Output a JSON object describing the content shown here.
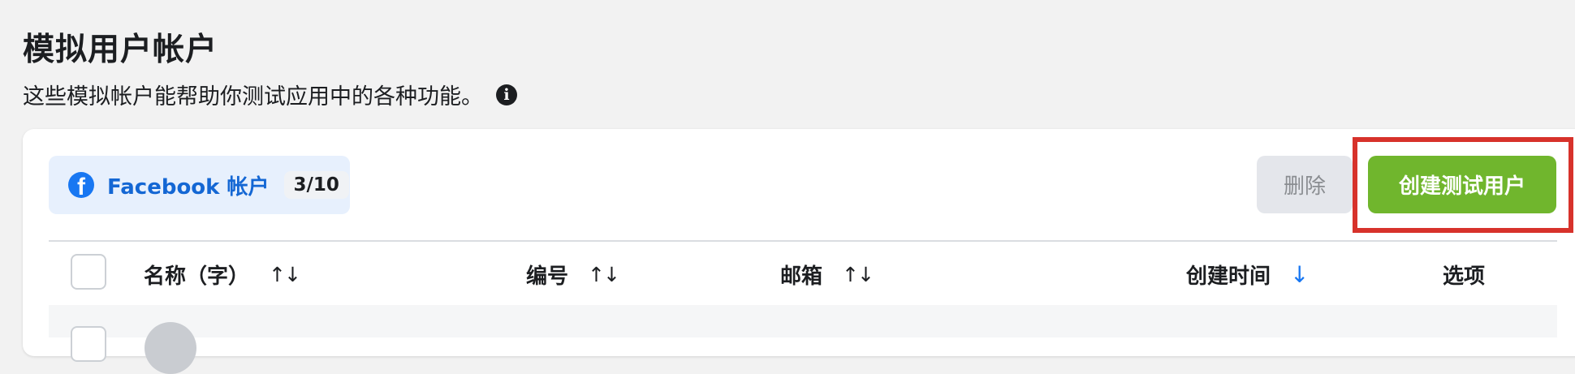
{
  "page": {
    "title": "模拟用户帐户",
    "subtitle": "这些模拟帐户能帮助你测试应用中的各种功能。",
    "info_icon": "info-icon"
  },
  "accounts_tab": {
    "icon": "facebook-icon",
    "label": "Facebook 帐户",
    "count": "3/10"
  },
  "toolbar": {
    "delete_label": "删除",
    "create_label": "创建测试用户"
  },
  "table": {
    "columns": [
      {
        "label": "名称（字）",
        "sort": "↑↓"
      },
      {
        "label": "编号",
        "sort": "↑↓"
      },
      {
        "label": "邮箱",
        "sort": "↑↓"
      },
      {
        "label": "创建时间",
        "sort": "↓"
      },
      {
        "label": "选项",
        "sort": ""
      }
    ]
  },
  "colors": {
    "accent_blue": "#1877f2",
    "create_green": "#70b62d",
    "highlight_red": "#d7322b",
    "tab_bg": "#e7f0fd"
  }
}
